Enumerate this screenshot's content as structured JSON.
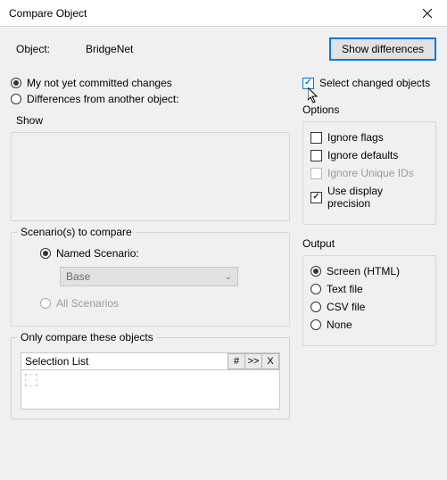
{
  "window": {
    "title": "Compare Object"
  },
  "header": {
    "object_label": "Object:",
    "object_value": "BridgeNet",
    "show_diff_label": "Show differences"
  },
  "mode": {
    "my_changes": "My not yet committed changes",
    "diff_other": "Differences from another object:"
  },
  "show_label": "Show",
  "scenarios": {
    "legend": "Scenario(s) to compare",
    "named": "Named Scenario:",
    "selected": "Base",
    "all": "All Scenarios"
  },
  "only": {
    "legend": "Only compare these objects",
    "list_label": "Selection List",
    "btn_hash": "#",
    "btn_next": ">>",
    "btn_x": "X"
  },
  "select_changed": "Select changed objects",
  "options": {
    "heading": "Options",
    "ignore_flags": "Ignore flags",
    "ignore_defaults": "Ignore defaults",
    "ignore_unique": "Ignore Unique IDs",
    "use_precision": "Use display precision"
  },
  "output": {
    "heading": "Output",
    "screen": "Screen (HTML)",
    "text": "Text file",
    "csv": "CSV file",
    "none": "None"
  }
}
